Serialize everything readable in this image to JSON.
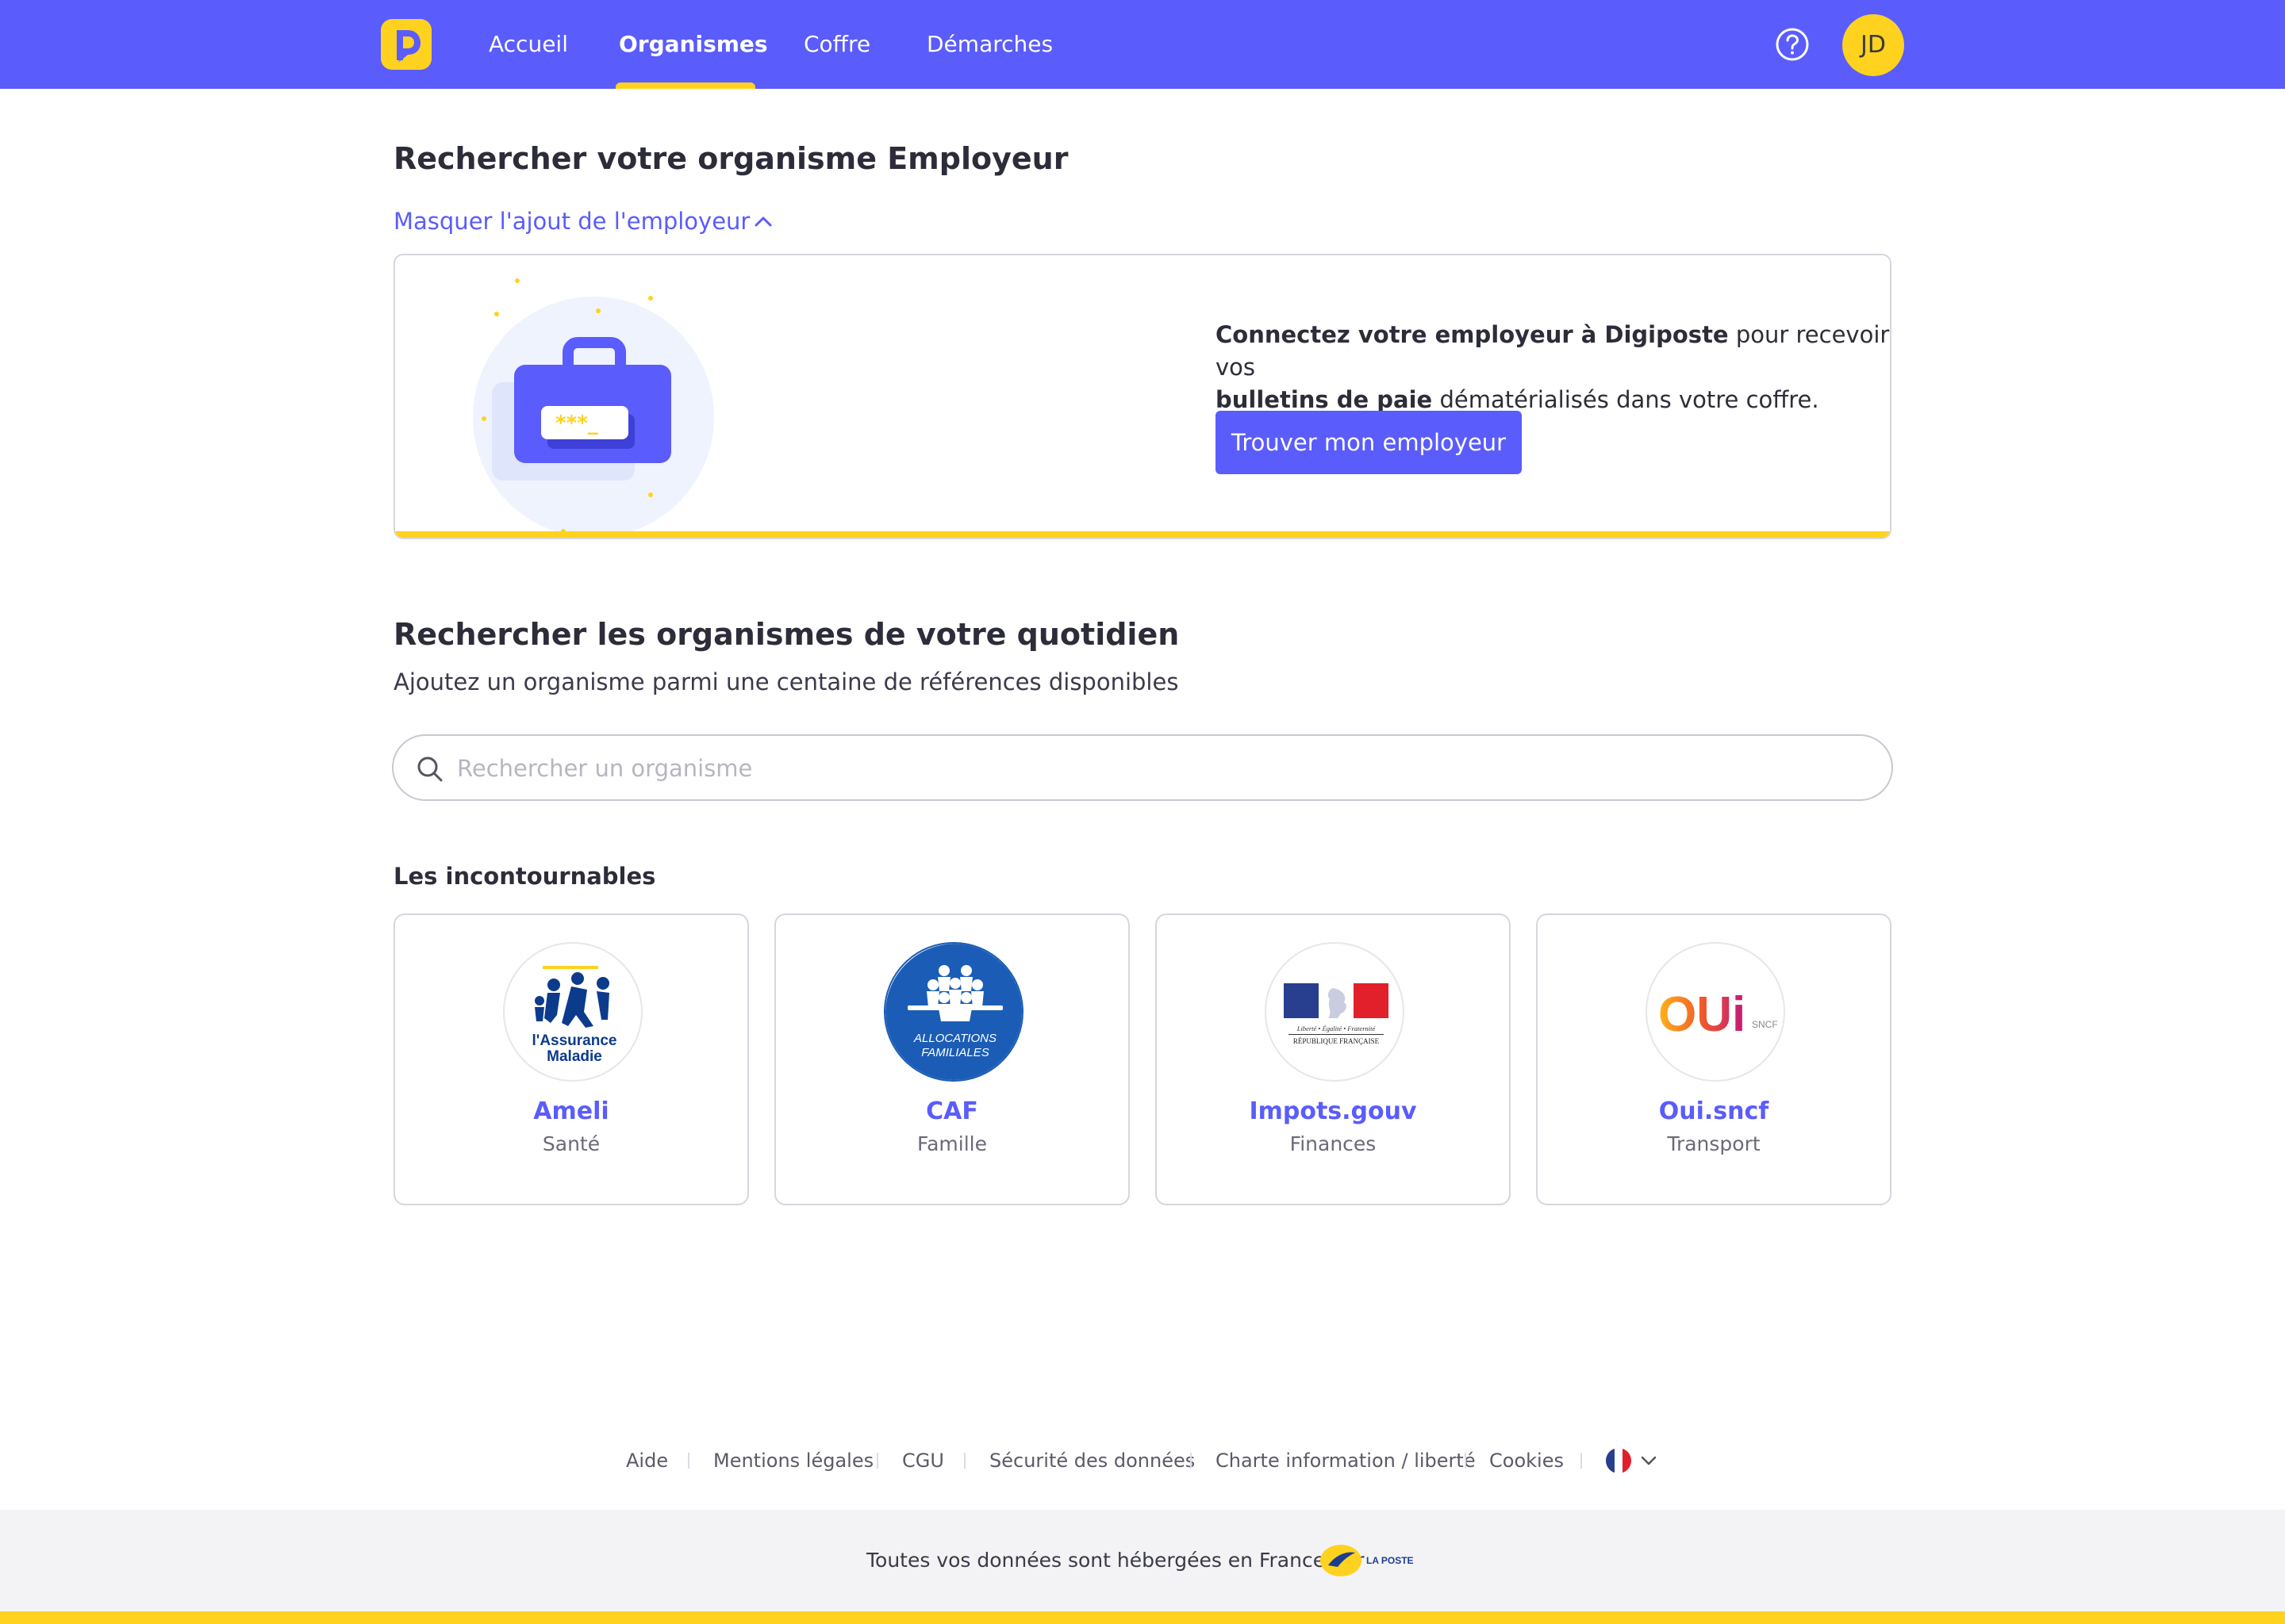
{
  "nav": {
    "items": [
      {
        "label": "Accueil"
      },
      {
        "label": "Organismes"
      },
      {
        "label": "Coffre"
      },
      {
        "label": "Démarches"
      }
    ],
    "avatar_initials": "JD",
    "accent": "#5a5cfc",
    "highlight": "#ffd21f"
  },
  "employer": {
    "title": "Rechercher votre organisme Employeur",
    "toggle_label": "Masquer l'ajout de l'employeur",
    "text_bold1": "Connectez votre employeur à Digiposte",
    "text_normal1": " pour recevoir automatiquement tous vos ",
    "text_bold2": "bulletins de paie",
    "text_normal2": " dématérialisés dans votre coffre.",
    "button_label": "Trouver mon employeur",
    "illustration_icon": "briefcase-password-icon"
  },
  "daily": {
    "title": "Rechercher les organismes de votre quotidien",
    "subtitle": "Ajoutez un organisme parmi une centaine de références disponibles",
    "search_placeholder": "Rechercher un organisme",
    "search_value": "",
    "section_label": "Les incontournables",
    "orgs": [
      {
        "name": "Ameli",
        "category": "Santé",
        "logo_text1": "l'Assurance",
        "logo_text2": "Maladie"
      },
      {
        "name": "CAF",
        "category": "Famille",
        "logo_text1": "ALLOCATIONS",
        "logo_text2": "FAMILIALES"
      },
      {
        "name": "Impots.gouv",
        "category": "Finances",
        "logo_text1": "Liberté • Égalité • Fraternité",
        "logo_text2": "RÉPUBLIQUE FRANÇAISE"
      },
      {
        "name": "Oui.sncf",
        "category": "Transport",
        "logo_text1": "OUi",
        "logo_text2": "SNCF"
      }
    ]
  },
  "footer": {
    "links": [
      "Aide",
      "Mentions légales",
      "CGU",
      "Sécurité des données",
      "Charte information / liberté",
      "Cookies"
    ],
    "note": "Toutes vos données sont hébergées en France par",
    "brand": "LA POSTE"
  }
}
